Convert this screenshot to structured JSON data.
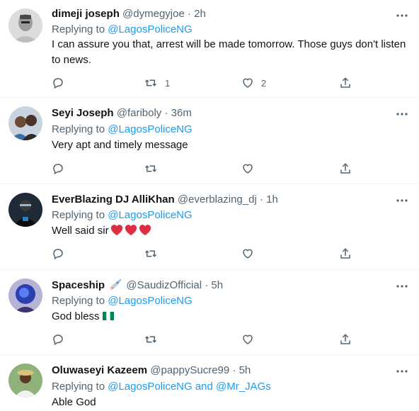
{
  "tweets": [
    {
      "name": "dimeji joseph",
      "handle": "@dymegyjoe",
      "dot": "·",
      "time": "2h",
      "replying_prefix": "Replying to ",
      "mentions": [
        "@LagosPoliceNG"
      ],
      "text": "I can assure you that, arrest will be made tomorrow. Those guys don't listen to news.",
      "retweets": "1",
      "likes": "2"
    },
    {
      "name": "Seyi Joseph",
      "handle": "@fariboly",
      "dot": "·",
      "time": "36m",
      "replying_prefix": "Replying to ",
      "mentions": [
        "@LagosPoliceNG"
      ],
      "text": "Very apt and timely message",
      "retweets": "",
      "likes": ""
    },
    {
      "name": "EverBlazing DJ AlliKhan",
      "handle": "@everblazing_dj",
      "dot": "·",
      "time": "1h",
      "replying_prefix": "Replying to ",
      "mentions": [
        "@LagosPoliceNG"
      ],
      "text": "Well said sir",
      "retweets": "",
      "likes": ""
    },
    {
      "name": "Spaceship",
      "handle": "@SaudizOfficial",
      "dot": "·",
      "time": "5h",
      "replying_prefix": "Replying to ",
      "mentions": [
        "@LagosPoliceNG"
      ],
      "text": "God bless",
      "retweets": "",
      "likes": ""
    },
    {
      "name": "Oluwaseyi Kazeem",
      "handle": "@pappySucre99",
      "dot": "·",
      "time": "5h",
      "replying_prefix": "Replying to ",
      "mentions": [
        "@LagosPoliceNG",
        "@Mr_JAGs"
      ],
      "mention_joiner": " and ",
      "text": "Able God",
      "retweets": "",
      "likes": ""
    }
  ],
  "icons": {
    "reply": "reply-icon",
    "retweet": "retweet-icon",
    "like": "heart-icon",
    "share": "share-icon",
    "more": "more-icon",
    "rocket": "rocket-icon",
    "flag": "nigeria-flag-icon",
    "heart_emoji": "red-heart-icon"
  },
  "colors": {
    "link": "#1d9bf0",
    "secondary": "#536471",
    "heart": "#e0245e"
  }
}
